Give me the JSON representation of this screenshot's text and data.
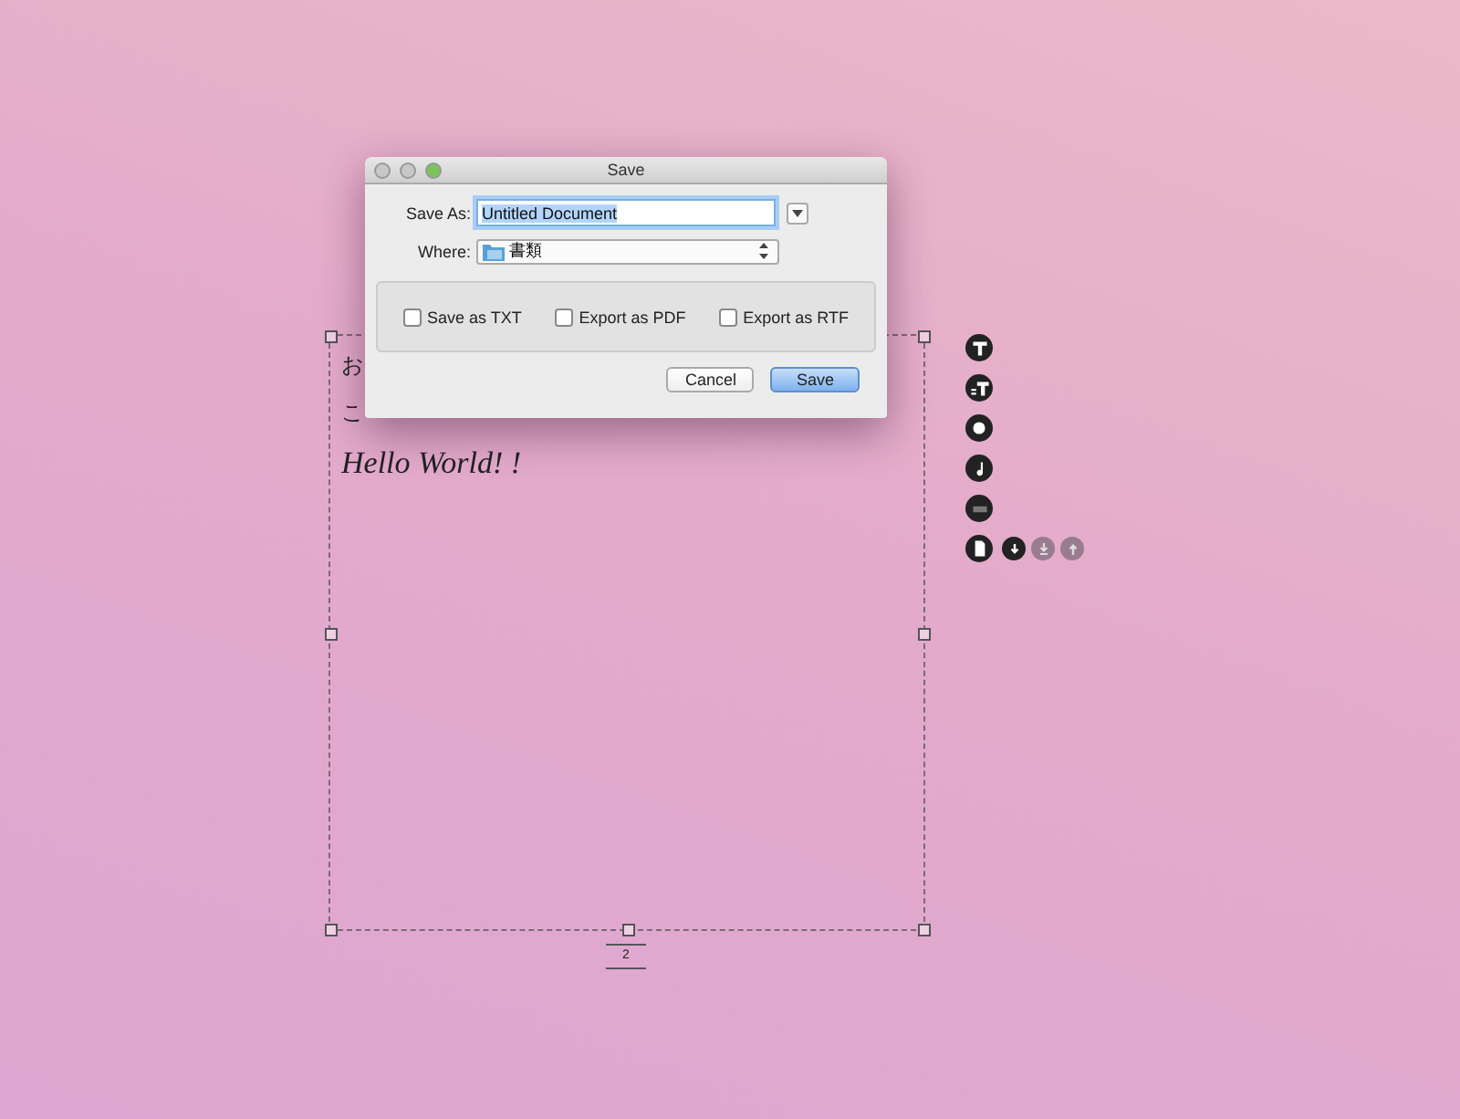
{
  "document": {
    "lines": [
      {
        "text": "お",
        "kind": "plain"
      },
      {
        "text": "こ",
        "kind": "plain"
      },
      {
        "text": "Hello World! !",
        "kind": "script"
      }
    ],
    "page_number": "2"
  },
  "toolbar": {
    "tools": [
      {
        "kind": "text"
      },
      {
        "kind": "textsize"
      },
      {
        "kind": "dot"
      },
      {
        "kind": "note"
      },
      {
        "kind": "keyboard"
      },
      {
        "kind": "page"
      }
    ],
    "page_actions": [
      {
        "kind": "down",
        "disabled": false
      },
      {
        "kind": "downbar",
        "disabled": true
      },
      {
        "kind": "up",
        "disabled": true
      }
    ]
  },
  "dialog": {
    "title": "Save",
    "save_as_label": "Save As:",
    "filename": "Untitled Document",
    "where_label": "Where:",
    "folder": "書類",
    "options": [
      {
        "label": "Save as TXT",
        "checked": false
      },
      {
        "label": "Export as PDF",
        "checked": false
      },
      {
        "label": "Export as RTF",
        "checked": false
      }
    ],
    "buttons": [
      {
        "label": "Cancel",
        "default": false
      },
      {
        "label": "Save",
        "default": true
      }
    ]
  }
}
